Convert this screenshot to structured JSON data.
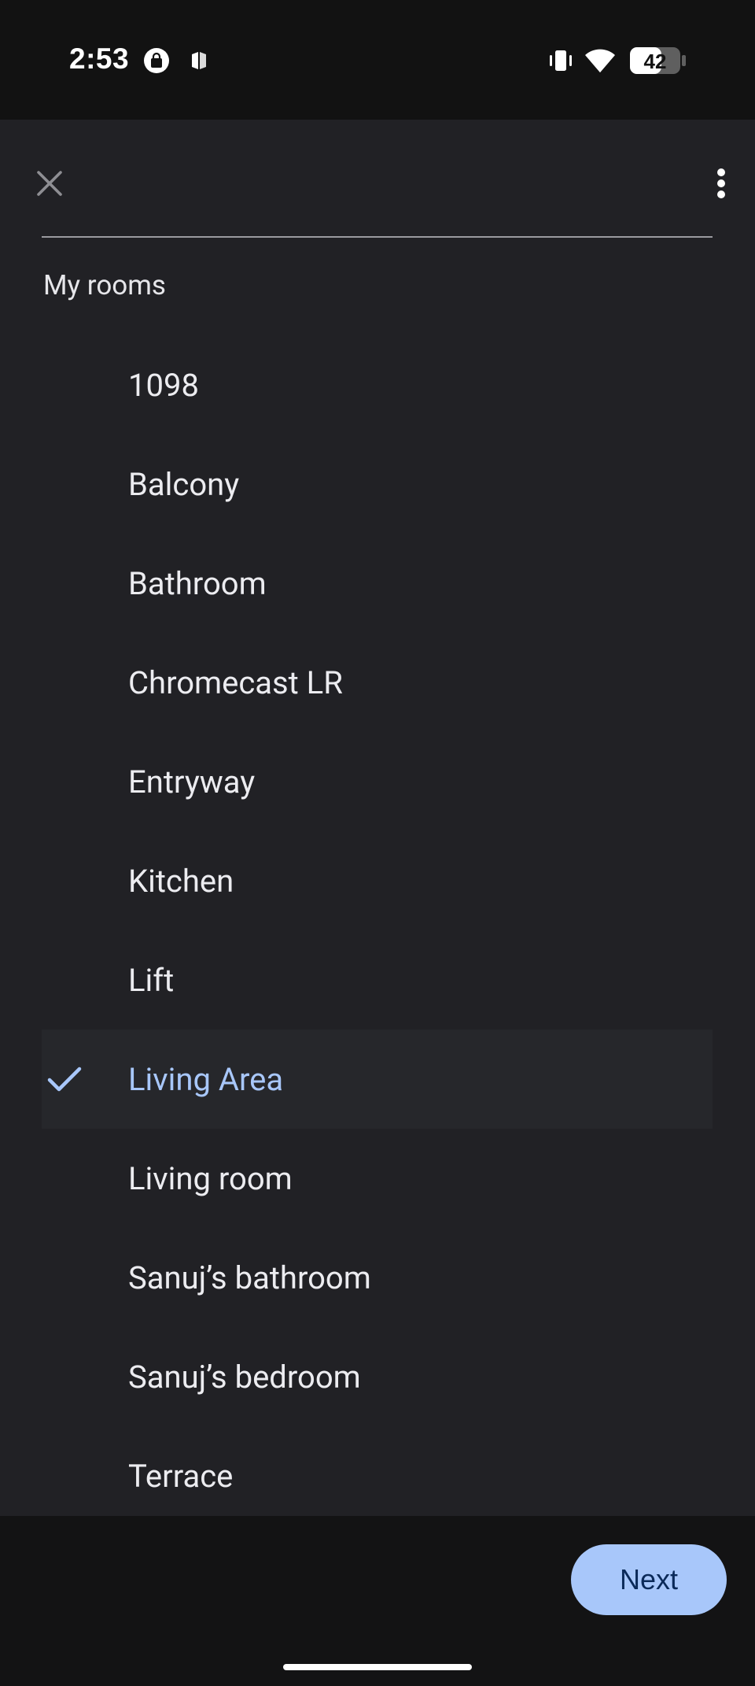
{
  "status_bar": {
    "time": "2:53",
    "battery_level": "42",
    "icons": [
      "shopping-bag-icon",
      "app-notification-icon",
      "vibrate-icon",
      "wifi-icon",
      "battery-icon"
    ]
  },
  "toolbar": {
    "close_icon": "close-icon",
    "more_icon": "more-vert-icon"
  },
  "section_title": "My rooms",
  "rooms": [
    {
      "label": "1098",
      "selected": false
    },
    {
      "label": "Balcony",
      "selected": false
    },
    {
      "label": "Bathroom",
      "selected": false
    },
    {
      "label": "Chromecast LR",
      "selected": false
    },
    {
      "label": "Entryway",
      "selected": false
    },
    {
      "label": "Kitchen",
      "selected": false
    },
    {
      "label": "Lift",
      "selected": false
    },
    {
      "label": "Living Area",
      "selected": true
    },
    {
      "label": "Living room",
      "selected": false
    },
    {
      "label": "Sanuj’s bathroom",
      "selected": false
    },
    {
      "label": "Sanuj’s bedroom",
      "selected": false
    },
    {
      "label": "Terrace",
      "selected": false
    }
  ],
  "footer": {
    "next_label": "Next"
  },
  "colors": {
    "accent": "#a8c7fa",
    "sheet_bg": "#212125",
    "system_bg": "#131314"
  }
}
